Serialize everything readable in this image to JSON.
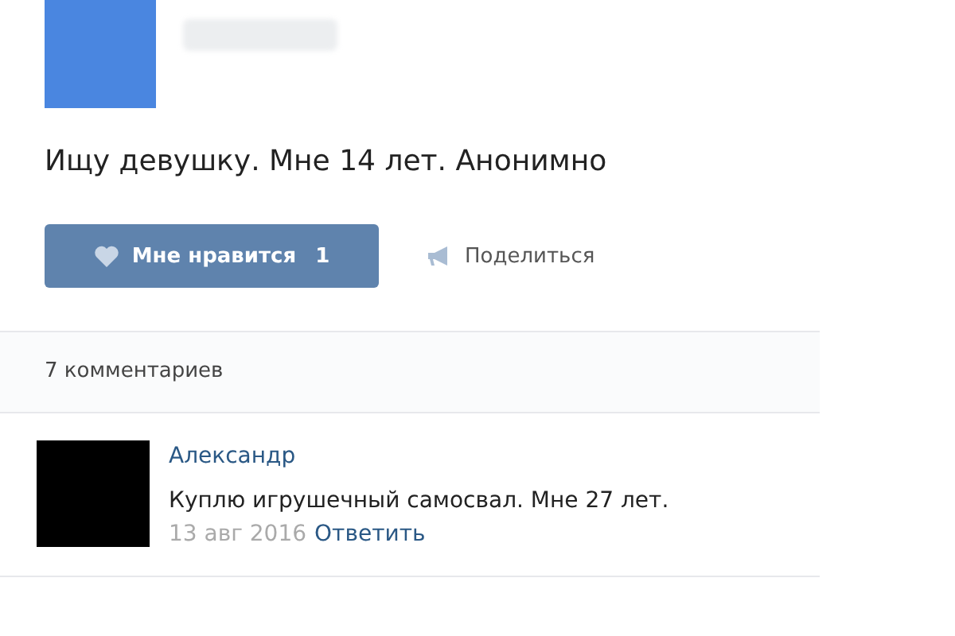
{
  "post": {
    "text": "Ищу девушку. Мне 14 лет. Анонимно",
    "like": {
      "label": "Мне нравится",
      "count": "1"
    },
    "share": {
      "label": "Поделиться"
    }
  },
  "comments_header": "7 комментариев",
  "comments": [
    {
      "author": "Александр",
      "text": "Куплю игрушечный самосвал. Мне 27 лет.",
      "date": "13 авг 2016",
      "reply": "Ответить"
    }
  ]
}
